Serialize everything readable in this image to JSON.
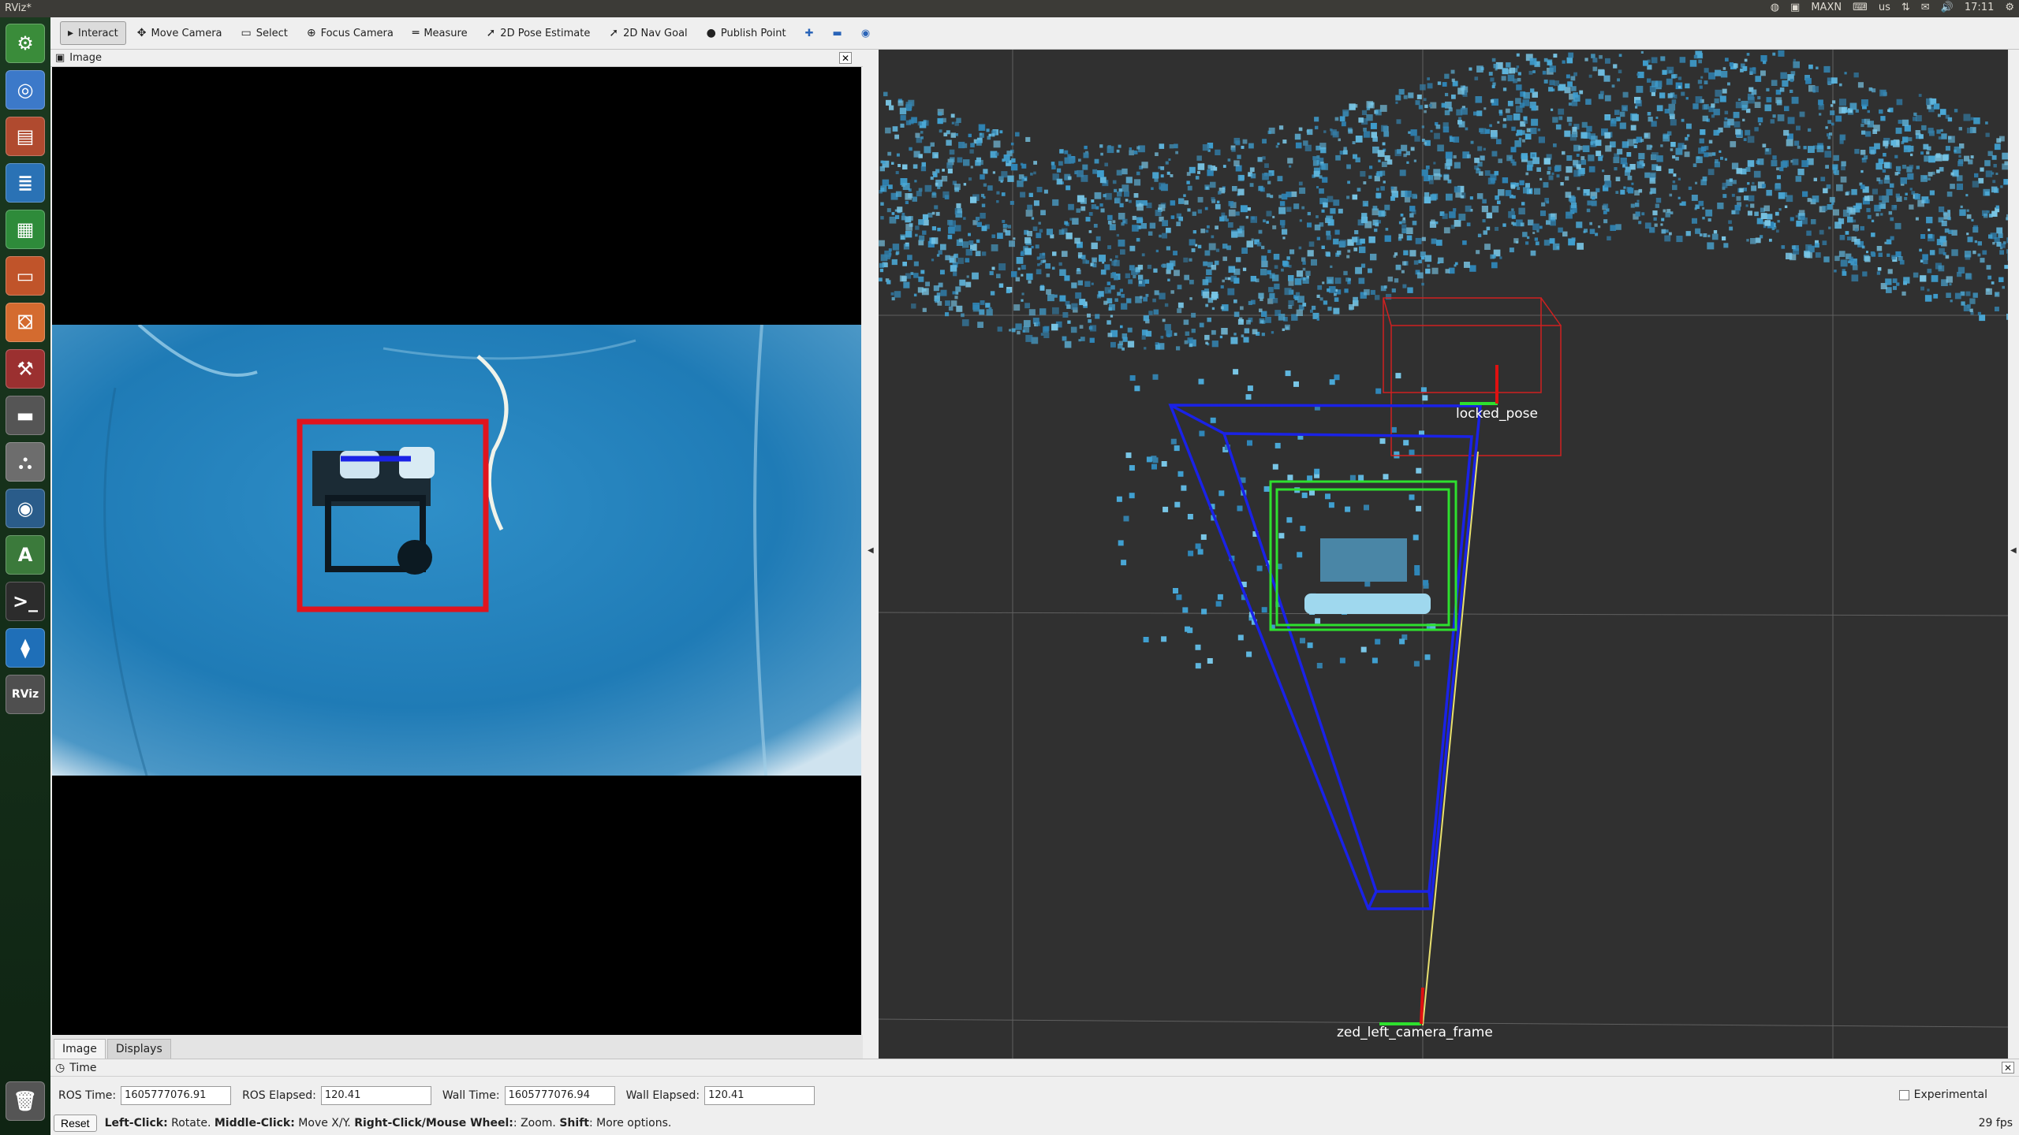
{
  "window": {
    "title": "RViz*"
  },
  "tray": {
    "power_mode": "MAXN",
    "keyboard": "us",
    "clock": "17:11"
  },
  "launcher": [
    {
      "icon": "ubuntu-settings-icon",
      "color": "#3a8c3a",
      "glyph": "⚙"
    },
    {
      "icon": "chromium-icon",
      "color": "#3c79c9",
      "glyph": "◎"
    },
    {
      "icon": "files-icon",
      "color": "#b04a2f",
      "glyph": "▤"
    },
    {
      "icon": "writer-icon",
      "color": "#2a72b5",
      "glyph": "≣"
    },
    {
      "icon": "calc-icon",
      "color": "#2e8b3a",
      "glyph": "▦"
    },
    {
      "icon": "impress-icon",
      "color": "#c0542a",
      "glyph": "▭"
    },
    {
      "icon": "software-center-icon",
      "color": "#d46b2f",
      "glyph": "⛋"
    },
    {
      "icon": "system-settings-icon",
      "color": "#9b3030",
      "glyph": "⚒"
    },
    {
      "icon": "drive-icon",
      "color": "#555555",
      "glyph": "▬"
    },
    {
      "icon": "rviz-mount-icon",
      "color": "#6d6d6d",
      "glyph": "⛬"
    },
    {
      "icon": "camera-app-icon",
      "color": "#2a5c8a",
      "glyph": "◉"
    },
    {
      "icon": "updater-icon",
      "color": "#3b7a3b",
      "glyph": "A"
    },
    {
      "icon": "terminal-icon",
      "color": "#2c2c2c",
      "glyph": ">_"
    },
    {
      "icon": "vscode-icon",
      "color": "#1f6fb8",
      "glyph": "⧫"
    },
    {
      "icon": "rviz-icon",
      "color": "#4f4f4f",
      "glyph": "RViz"
    },
    {
      "icon": "trash-icon",
      "color": "#555555",
      "glyph": "🗑"
    }
  ],
  "toolbar": {
    "tools": [
      {
        "name": "interact",
        "label": "Interact",
        "icon": "▸",
        "active": true
      },
      {
        "name": "move-camera",
        "label": "Move Camera",
        "icon": "✥"
      },
      {
        "name": "select",
        "label": "Select",
        "icon": "▭"
      },
      {
        "name": "focus-camera",
        "label": "Focus Camera",
        "icon": "⊕"
      },
      {
        "name": "measure",
        "label": "Measure",
        "icon": "═"
      },
      {
        "name": "2d-pose-estimate",
        "label": "2D Pose Estimate",
        "icon": "➚"
      },
      {
        "name": "2d-nav-goal",
        "label": "2D Nav Goal",
        "icon": "➚"
      },
      {
        "name": "publish-point",
        "label": "Publish Point",
        "icon": "●"
      }
    ],
    "extra_icons": [
      "plus-icon",
      "minus-icon",
      "eye-icon"
    ]
  },
  "image_panel": {
    "title": "Image"
  },
  "view3d": {
    "labels": {
      "locked_pose": "locked_pose",
      "camera_frame": "zed_left_camera_frame"
    }
  },
  "tabs": [
    {
      "label": "Image",
      "active": true
    },
    {
      "label": "Displays"
    }
  ],
  "time_panel": {
    "title": "Time",
    "ros_time_label": "ROS Time:",
    "ros_time": "1605777076.91",
    "ros_elapsed_label": "ROS Elapsed:",
    "ros_elapsed": "120.41",
    "wall_time_label": "Wall Time:",
    "wall_time": "1605777076.94",
    "wall_elapsed_label": "Wall Elapsed:",
    "wall_elapsed": "120.41",
    "experimental_label": "Experimental"
  },
  "status": {
    "reset_label": "Reset",
    "hint_left_key": "Left-Click:",
    "hint_left": " Rotate.",
    "hint_middle_key": "Middle-Click:",
    "hint_middle": " Move X/Y.",
    "hint_right_key": "Right-Click/Mouse Wheel:",
    "hint_right": ": Zoom.",
    "hint_shift_key": "Shift",
    "hint_shift": ": More options.",
    "fps": "29 fps"
  },
  "colors": {
    "detection_box": "#e0141e",
    "frustum": "#1a22e6",
    "bbox3d": "#2ee02e",
    "pointcloud": "#3f9fd0"
  }
}
